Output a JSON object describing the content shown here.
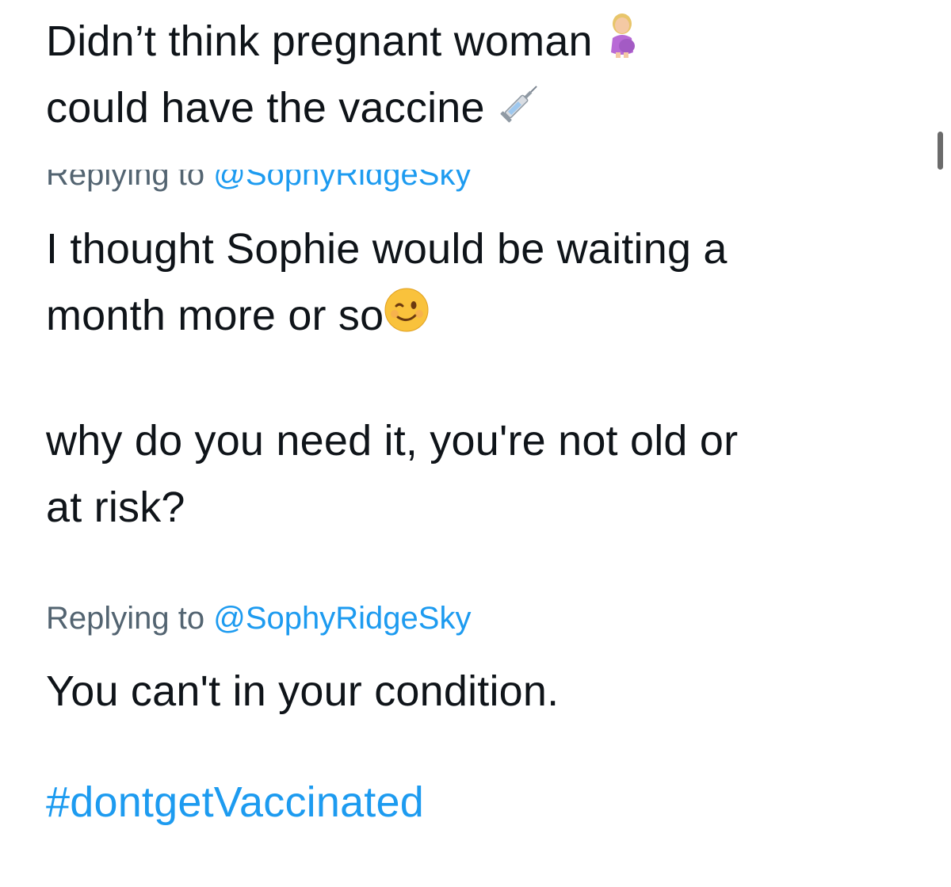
{
  "tweet1": {
    "line1": "Didn’t think pregnant woman",
    "line2": "could have the vaccine",
    "emoji1": "pregnant-woman-emoji",
    "emoji2": "syringe-emoji"
  },
  "reply1": {
    "replying_prefix": "Replying to",
    "handle": "@SophyRidgeSky",
    "line1": "I thought Sophie would be waiting a",
    "line2": "month more or so",
    "emoji": "winking-face-emoji",
    "line3": "why do you need it, you're not old or",
    "line4": "at risk?"
  },
  "reply2": {
    "replying_prefix": "Replying to",
    "handle": "@SophyRidgeSky",
    "text": "You can't in your condition.",
    "hashtag": "#dontgetVaccinated"
  },
  "colors": {
    "link": "#1d9bf0",
    "muted": "#536471",
    "text": "#0f1419"
  }
}
